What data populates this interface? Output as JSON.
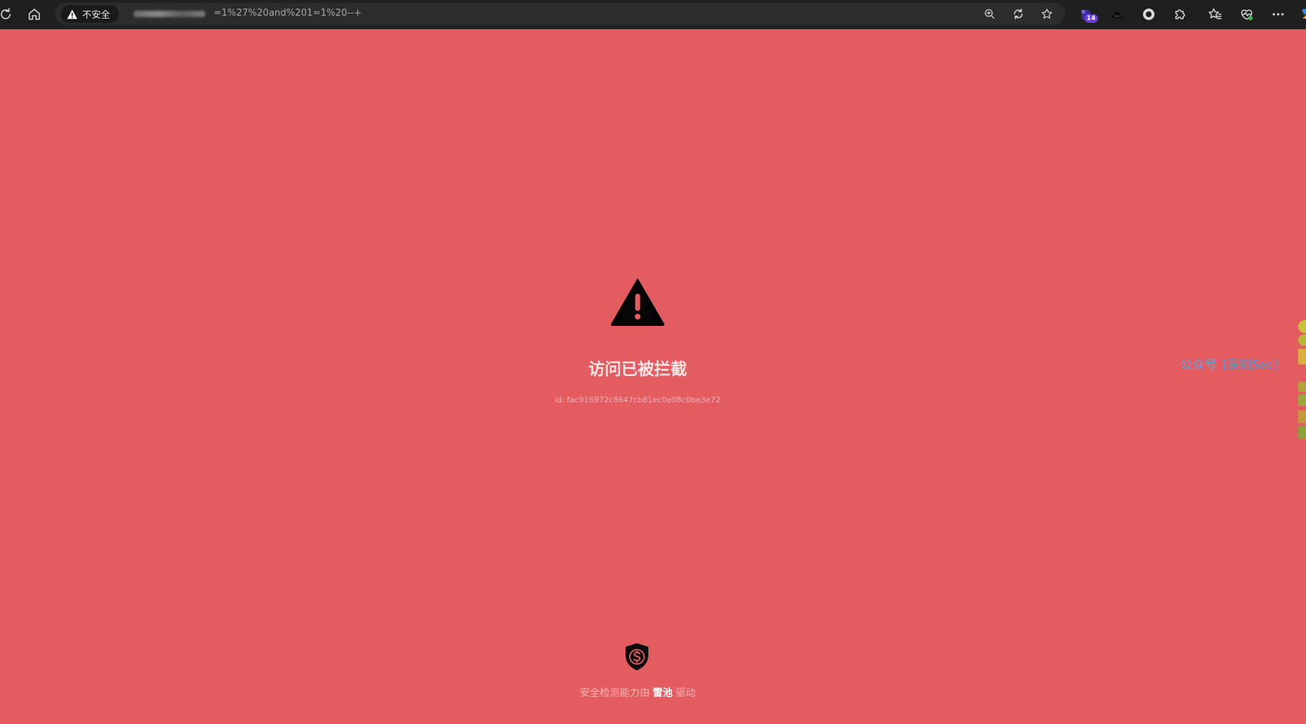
{
  "browser": {
    "security_label": "不安全",
    "url_visible": "=1%27%20and%201=1%20--+",
    "extension_badge": "14",
    "icons": {
      "reload": "reload-icon",
      "home": "home-icon",
      "warning": "warning-triangle-icon",
      "zoom": "zoom-icon",
      "refresh_page": "refresh-page-icon",
      "favorite": "star-icon",
      "extension_1": "extension-icon",
      "extension_2": "hat-icon",
      "extension_3": "record-icon",
      "extensions": "puzzle-icon",
      "favorites": "favorites-icon",
      "health": "heart-pulse-icon",
      "more": "more-icon"
    }
  },
  "page": {
    "background_color": "#e25c60",
    "title": "访问已被拦截",
    "request_id": "id: fac916972c8647cb81ec0e08c0be3e72",
    "footer": {
      "prefix": "安全检测能力由",
      "brand": "雷池",
      "suffix": "驱动"
    }
  },
  "overlay": {
    "label": "公众号",
    "bracket_text": "[深刻Sec]"
  }
}
